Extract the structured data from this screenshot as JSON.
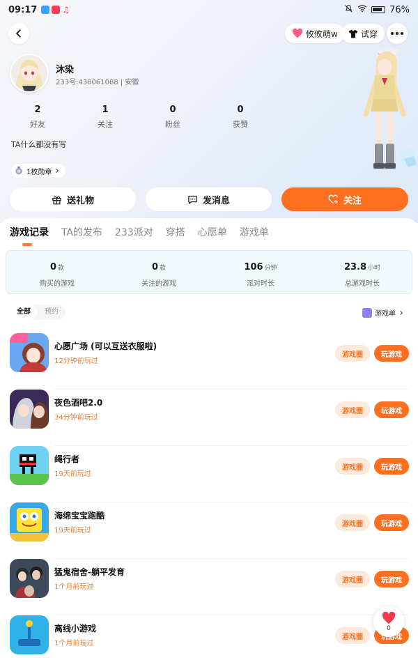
{
  "status_bar": {
    "time": "09:17",
    "battery": "76%"
  },
  "top_nav": {
    "mood_label": "攸攸萌w",
    "tryon_label": "试穿"
  },
  "profile": {
    "nickname": "沐染",
    "uid_line": "233号:438061088 | 安徽",
    "stats": [
      {
        "value": "2",
        "label": "好友"
      },
      {
        "value": "1",
        "label": "关注"
      },
      {
        "value": "0",
        "label": "粉丝"
      },
      {
        "value": "0",
        "label": "获赞"
      }
    ],
    "bio": "TA什么都没有写",
    "badge_label": "1枚勋章"
  },
  "actions": {
    "gift_label": "送礼物",
    "message_label": "发消息",
    "follow_label": "关注"
  },
  "tabs": [
    "游戏记录",
    "TA的发布",
    "233派对",
    "穿搭",
    "心愿单",
    "游戏单"
  ],
  "summary": [
    {
      "value": "0",
      "unit": "款",
      "label": "购买的游戏"
    },
    {
      "value": "0",
      "unit": "款",
      "label": "关注的游戏"
    },
    {
      "value": "106",
      "unit": "分钟",
      "label": "派对时长"
    },
    {
      "value": "23.8",
      "unit": "小时",
      "label": "总游戏时长"
    }
  ],
  "filter": {
    "all": "全部",
    "reserve": "预约",
    "gamelist": "游戏单"
  },
  "games": [
    {
      "name": "心愿广场 (可以互送衣服啦)",
      "time": "12分钟前玩过",
      "circle": "游戏圈",
      "play": "玩游戏"
    },
    {
      "name": "夜色酒吧2.0",
      "time": "34分钟前玩过",
      "circle": "游戏圈",
      "play": "玩游戏"
    },
    {
      "name": "绳行者",
      "time": "19天前玩过",
      "circle": "游戏圈",
      "play": "玩游戏"
    },
    {
      "name": "海绵宝宝跑酷",
      "time": "19天前玩过",
      "circle": "游戏圈",
      "play": "玩游戏"
    },
    {
      "name": "猛鬼宿舍-躺平发育",
      "time": "1个月前玩过",
      "circle": "游戏圈",
      "play": "玩游戏"
    },
    {
      "name": "离线小游戏",
      "time": "1个月前玩过",
      "circle": "游戏圈",
      "play": "玩游戏"
    }
  ],
  "floating": {
    "count": "0"
  },
  "colors": {
    "accent": "#ff6f1f",
    "time_text": "#e87c2e",
    "circle_bg": "#fde9dc"
  }
}
